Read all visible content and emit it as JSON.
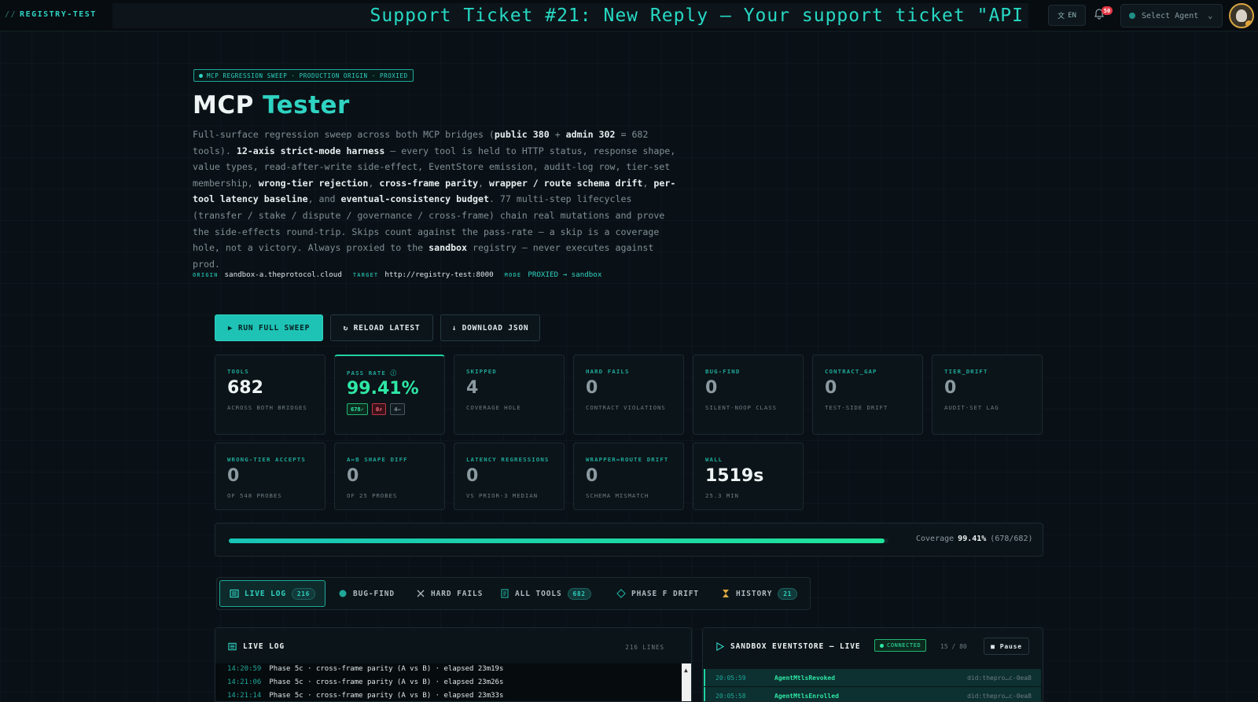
{
  "topbar": {
    "brand_prefix": "//",
    "brand": "REGISTRY-TEST",
    "marquee": "Support Ticket #21: New Reply — Your support ticket \"API",
    "lang": "EN",
    "notif_count": "50",
    "agent_placeholder": "Select Agent"
  },
  "hero": {
    "tagline": "MCP REGRESSION SWEEP · PRODUCTION ORIGIN · PROXIED",
    "title_a": "MCP",
    "title_b": "Tester",
    "desc": {
      "p1": "Full-surface regression sweep across both MCP bridges (",
      "b1": "public 380",
      "p2": " + ",
      "b2": "admin 302",
      "p3": " = 682 tools). ",
      "b3": "12-axis strict-mode harness",
      "p4": " — every tool is held to HTTP status, response shape, value types, read-after-write side-effect, EventStore emission, audit-log row, tier-set membership, ",
      "b4": "wrong-tier rejection",
      "p5": ", ",
      "b5": "cross-frame parity",
      "p6": ", ",
      "b6": "wrapper / route schema drift",
      "p7": ", ",
      "b7": "per-tool latency baseline",
      "p8": ", and ",
      "b8": "eventual-consistency budget",
      "p9": ". 77 multi-step lifecycles (transfer / stake / dispute / governance / cross-frame) chain real mutations and prove the side-effects round-trip. Skips count against the pass-rate — a skip is a coverage hole, not a victory. Always proxied to the ",
      "b9": "sandbox",
      "p10": " registry — never executes against prod."
    },
    "meta": {
      "origin_key": "ORIGIN",
      "origin": "sandbox-a.theprotocol.cloud",
      "target_key": "TARGET",
      "target": "http://registry-test:8000",
      "mode_key": "MODE",
      "mode": "PROXIED → sandbox"
    }
  },
  "actions": {
    "run": "▶ RUN FULL SWEEP",
    "reload": "↻ RELOAD LATEST",
    "download": "↓ DOWNLOAD JSON"
  },
  "stats": [
    {
      "label": "TOOLS",
      "value": "682",
      "sub": "ACROSS BOTH BRIDGES"
    },
    {
      "label": "PASS RATE ⓘ",
      "value": "99.41%",
      "pass": "678✓",
      "fail": "0✗",
      "skip": "4–"
    },
    {
      "label": "SKIPPED",
      "value": "4",
      "sub": "COVERAGE HOLE"
    },
    {
      "label": "HARD FAILS",
      "value": "0",
      "sub": "CONTRACT VIOLATIONS"
    },
    {
      "label": "BUG-FIND",
      "value": "0",
      "sub": "SILENT-NOOP CLASS"
    },
    {
      "label": "CONTRACT_GAP",
      "value": "0",
      "sub": "TEST-SIDE DRIFT"
    },
    {
      "label": "TIER_DRIFT",
      "value": "0",
      "sub": "AUDIT-SET LAG"
    },
    {
      "label": "WRONG-TIER ACCEPTS",
      "value": "0",
      "sub": "OF 548 PROBES"
    },
    {
      "label": "A↔B SHAPE DIFF",
      "value": "0",
      "sub": "OF 25 PROBES"
    },
    {
      "label": "LATENCY REGRESSIONS",
      "value": "0",
      "sub": "VS PRIOR-3 MEDIAN"
    },
    {
      "label": "WRAPPER↔ROUTE DRIFT",
      "value": "0",
      "sub": "SCHEMA MISMATCH"
    },
    {
      "label": "WALL",
      "value": "1519s",
      "sub": "25.3 MIN"
    }
  ],
  "coverage": {
    "label": "Coverage",
    "pct": "99.41%",
    "ratio": "(678/682)",
    "fraction": 0.9941
  },
  "tabs": [
    {
      "label": "LIVE LOG",
      "count": "216"
    },
    {
      "label": "BUG-FIND",
      "count": ""
    },
    {
      "label": "HARD FAILS",
      "count": ""
    },
    {
      "label": "ALL TOOLS",
      "count": "682"
    },
    {
      "label": "PHASE F DRIFT",
      "count": ""
    },
    {
      "label": "HISTORY",
      "count": "21"
    }
  ],
  "live_log": {
    "title": "LIVE LOG",
    "lines_label": "216 LINES",
    "lines": [
      {
        "time": "14:20:59",
        "text": "Phase 5c · cross-frame parity (A vs B) · elapsed 23m19s"
      },
      {
        "time": "14:21:06",
        "text": "Phase 5c · cross-frame parity (A vs B) · elapsed 23m26s"
      },
      {
        "time": "14:21:14",
        "text": "Phase 5c · cross-frame parity (A vs B) · elapsed 23m33s"
      }
    ]
  },
  "eventstore": {
    "title": "SANDBOX EVENTSTORE — LIVE",
    "status": "CONNECTED",
    "count": "15 / 80",
    "pause": "Pause",
    "events": [
      {
        "time": "20:05:59",
        "name": "AgentMtlsRevoked",
        "agent": "did:thepro…c-0ea8"
      },
      {
        "time": "20:05:58",
        "name": "AgentMtlsEnrolled",
        "agent": "did:thepro…c-0ea8"
      }
    ]
  },
  "colors": {
    "accent": "#2fd3c2",
    "pass": "#2ee7a5",
    "fail": "#ff6b7b",
    "background": "#0a1116"
  }
}
